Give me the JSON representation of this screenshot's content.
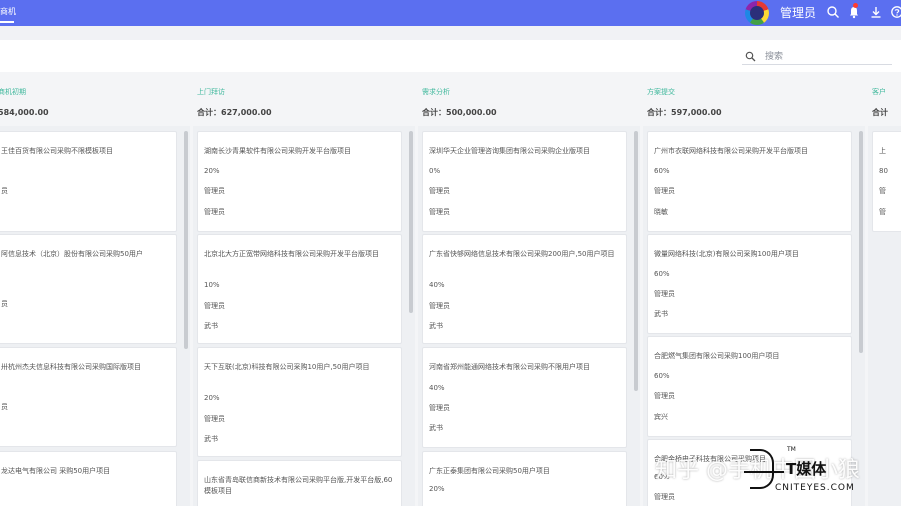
{
  "topbar": {
    "tab_label": "商机",
    "user_name": "管理员",
    "icons": [
      "search-icon",
      "bell-icon",
      "download-icon",
      "help-icon"
    ]
  },
  "search": {
    "placeholder": "搜索"
  },
  "columns": [
    {
      "name": "",
      "total": "584,000.00",
      "cards": [
        {
          "title": "王佳百货有限公司采购不限模板项目",
          "lines": [
            "",
            "员",
            ""
          ]
        },
        {
          "title": "阿信息技术（北京）股份有限公司采购50用户",
          "lines": [
            "",
            "员",
            ""
          ]
        },
        {
          "title": "卅杭州杰夫信息科技有限公司采购国际版项目",
          "lines": [
            "",
            "员",
            ""
          ]
        },
        {
          "title": "龙达电气有限公司 采购50用户项目",
          "lines": []
        }
      ]
    },
    {
      "name": "上门拜访",
      "total": "合计：627,000.00",
      "cards": [
        {
          "title": "湖南长沙青果软件有限公司采购开发平台版项目",
          "lines": [
            "20%",
            "管理员",
            "管理员"
          ]
        },
        {
          "title": "北京北大方正宽带网络科技有限公司采购开发平台版项目",
          "lines": [
            "10%",
            "管理员",
            "武书"
          ]
        },
        {
          "title": "天下互联(北京)科技有限公司采购10用户,50用户项目",
          "lines": [
            "20%",
            "管理员",
            "武书"
          ]
        },
        {
          "title": "山东省青岛联信商新技术有限公司采购平台版,开发平台版,60模板项目",
          "lines": []
        }
      ]
    },
    {
      "name": "需求分析",
      "total": "合计：500,000.00",
      "cards": [
        {
          "title": "深圳华天企业管理咨询集团有限公司采购企业版项目",
          "lines": [
            "0%",
            "管理员",
            "管理员"
          ]
        },
        {
          "title": "广东省快够网络信息技术有限公司采购200用户,50用户项目",
          "lines": [
            "40%",
            "管理员",
            "武书"
          ]
        },
        {
          "title": "河南省郑州能通网络技术有限公司采购不限用户项目",
          "lines": [
            "40%",
            "管理员",
            "武书"
          ]
        },
        {
          "title": "广东正泰集团有限公司采购50用户项目",
          "lines": [
            "20%"
          ]
        }
      ]
    },
    {
      "name": "方案提交",
      "total": "合计：597,000.00",
      "cards": [
        {
          "title": "广州市衣联网络科技有限公司采购开发平台版项目",
          "lines": [
            "60%",
            "管理员",
            "晓敏"
          ]
        },
        {
          "title": "微量网络科技(北京)有限公司采购100用户项目",
          "lines": [
            "60%",
            "管理员",
            "武书"
          ]
        },
        {
          "title": "合肥燃气集团有限公司采购100用户项目",
          "lines": [
            "60%",
            "管理员",
            "宾兴"
          ]
        },
        {
          "title": "合肥金桥电子科技有限公司采购项目",
          "lines": [
            "60%",
            "管理员"
          ]
        }
      ]
    },
    {
      "name": "客户",
      "total": "合计",
      "cards": [
        {
          "title": "上",
          "lines": [
            "80",
            "管",
            "管"
          ]
        }
      ]
    }
  ],
  "watermark": {
    "zhihu": "知乎 @手机中国小狼",
    "brand": "T媒体",
    "domain": "CNITEYES.COM",
    "tm": "TM"
  }
}
